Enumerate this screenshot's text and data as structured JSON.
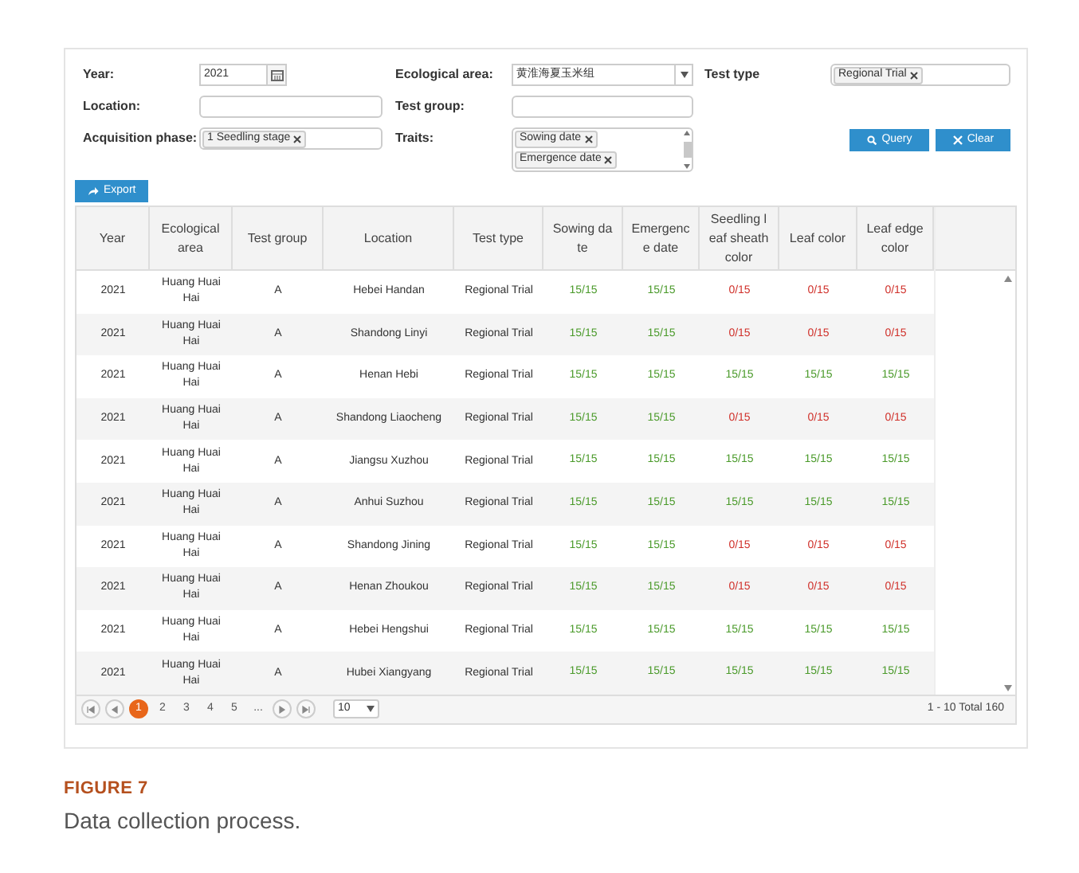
{
  "filters": {
    "year": {
      "label": "Year:",
      "value": "2021"
    },
    "ecological_area": {
      "label": "Ecological area:",
      "value": "黄淮海夏玉米组"
    },
    "test_type": {
      "label": "Test type",
      "tags": [
        "Regional Trial"
      ]
    },
    "location": {
      "label": "Location:"
    },
    "test_group": {
      "label": "Test group:"
    },
    "acquisition_phase": {
      "label": "Acquisition phase:",
      "tags": [
        "1 Seedling stage"
      ]
    },
    "traits": {
      "label": "Traits:",
      "tags": [
        "Sowing date",
        "Emergence date"
      ]
    },
    "buttons": [
      "Query",
      "Clear"
    ]
  },
  "export_button": "Export",
  "table": {
    "columns": [
      "Year",
      "Ecological area",
      "Test group",
      "Location",
      "Test type",
      "Sowing date",
      "Emergence date",
      "Seedling leaf sheath color",
      "Leaf color",
      "Leaf edge color"
    ],
    "rows": [
      {
        "cells": [
          "2021",
          "Huang Huai Hai",
          "A",
          "Hebei Handan",
          "Regional Trial"
        ],
        "traits": [
          {
            "value": "15/15",
            "color": "#4a9a2a"
          },
          {
            "value": "15/15",
            "color": "#4a9a2a"
          },
          {
            "value": "0/15",
            "color": "#d0302a"
          },
          {
            "value": "0/15",
            "color": "#d0302a"
          },
          {
            "value": "0/15",
            "color": "#d0302a"
          }
        ]
      },
      {
        "cells": [
          "2021",
          "Huang Huai Hai",
          "A",
          "Shandong Linyi",
          "Regional Trial"
        ],
        "traits": [
          {
            "value": "15/15",
            "color": "#4a9a2a"
          },
          {
            "value": "15/15",
            "color": "#4a9a2a"
          },
          {
            "value": "0/15",
            "color": "#d0302a"
          },
          {
            "value": "0/15",
            "color": "#d0302a"
          },
          {
            "value": "0/15",
            "color": "#d0302a"
          }
        ]
      },
      {
        "cells": [
          "2021",
          "Huang Huai Hai",
          "A",
          "Henan Hebi",
          "Regional Trial"
        ],
        "traits": [
          {
            "value": "15/15",
            "color": "#4a9a2a"
          },
          {
            "value": "15/15",
            "color": "#4a9a2a"
          },
          {
            "value": "15/15",
            "color": "#4a9a2a"
          },
          {
            "value": "15/15",
            "color": "#4a9a2a"
          },
          {
            "value": "15/15",
            "color": "#4a9a2a"
          }
        ]
      },
      {
        "cells": [
          "2021",
          "Huang Huai Hai",
          "A",
          "Shandong Liaocheng",
          "Regional Trial"
        ],
        "traits": [
          {
            "value": "15/15",
            "color": "#4a9a2a"
          },
          {
            "value": "15/15",
            "color": "#4a9a2a"
          },
          {
            "value": "0/15",
            "color": "#d0302a"
          },
          {
            "value": "0/15",
            "color": "#d0302a"
          },
          {
            "value": "0/15",
            "color": "#d0302a"
          }
        ]
      },
      {
        "cells": [
          "2021",
          "Huang Huai Hai",
          "A",
          "Jiangsu Xuzhou",
          "Regional Trial"
        ],
        "traits": [
          {
            "value": "15/15",
            "color": "#4a9a2a"
          },
          {
            "value": "15/15",
            "color": "#4a9a2a"
          },
          {
            "value": "15/15",
            "color": "#4a9a2a"
          },
          {
            "value": "15/15",
            "color": "#4a9a2a"
          },
          {
            "value": "15/15",
            "color": "#4a9a2a"
          }
        ]
      },
      {
        "cells": [
          "2021",
          "Huang Huai Hai",
          "A",
          "Anhui Suzhou",
          "Regional Trial"
        ],
        "traits": [
          {
            "value": "15/15",
            "color": "#4a9a2a"
          },
          {
            "value": "15/15",
            "color": "#4a9a2a"
          },
          {
            "value": "15/15",
            "color": "#4a9a2a"
          },
          {
            "value": "15/15",
            "color": "#4a9a2a"
          },
          {
            "value": "15/15",
            "color": "#4a9a2a"
          }
        ]
      },
      {
        "cells": [
          "2021",
          "Huang Huai Hai",
          "A",
          "Shandong Jining",
          "Regional Trial"
        ],
        "traits": [
          {
            "value": "15/15",
            "color": "#4a9a2a"
          },
          {
            "value": "15/15",
            "color": "#4a9a2a"
          },
          {
            "value": "0/15",
            "color": "#d0302a"
          },
          {
            "value": "0/15",
            "color": "#d0302a"
          },
          {
            "value": "0/15",
            "color": "#d0302a"
          }
        ]
      },
      {
        "cells": [
          "2021",
          "Huang Huai Hai",
          "A",
          "Henan Zhoukou",
          "Regional Trial"
        ],
        "traits": [
          {
            "value": "15/15",
            "color": "#4a9a2a"
          },
          {
            "value": "15/15",
            "color": "#4a9a2a"
          },
          {
            "value": "0/15",
            "color": "#d0302a"
          },
          {
            "value": "0/15",
            "color": "#d0302a"
          },
          {
            "value": "0/15",
            "color": "#d0302a"
          }
        ]
      },
      {
        "cells": [
          "2021",
          "Huang Huai Hai",
          "A",
          "Hebei Hengshui",
          "Regional Trial"
        ],
        "traits": [
          {
            "value": "15/15",
            "color": "#4a9a2a"
          },
          {
            "value": "15/15",
            "color": "#4a9a2a"
          },
          {
            "value": "15/15",
            "color": "#4a9a2a"
          },
          {
            "value": "15/15",
            "color": "#4a9a2a"
          },
          {
            "value": "15/15",
            "color": "#4a9a2a"
          }
        ]
      },
      {
        "cells": [
          "2021",
          "Huang Huai Hai",
          "A",
          "Hubei Xiangyang",
          "Regional Trial"
        ],
        "traits": [
          {
            "value": "15/15",
            "color": "#4a9a2a"
          },
          {
            "value": "15/15",
            "color": "#4a9a2a"
          },
          {
            "value": "15/15",
            "color": "#4a9a2a"
          },
          {
            "value": "15/15",
            "color": "#4a9a2a"
          },
          {
            "value": "15/15",
            "color": "#4a9a2a"
          }
        ]
      }
    ]
  },
  "pager": {
    "pages": [
      {
        "label": "1",
        "selected": true
      },
      {
        "label": "2",
        "selected": false
      },
      {
        "label": "3",
        "selected": false
      },
      {
        "label": "4",
        "selected": false
      },
      {
        "label": "5",
        "selected": false
      },
      {
        "label": "...",
        "selected": false
      }
    ],
    "page_size": "10",
    "summary": "1 - 10 Total 160"
  },
  "caption": {
    "label": "FIGURE 7",
    "text": "Data collection process."
  }
}
